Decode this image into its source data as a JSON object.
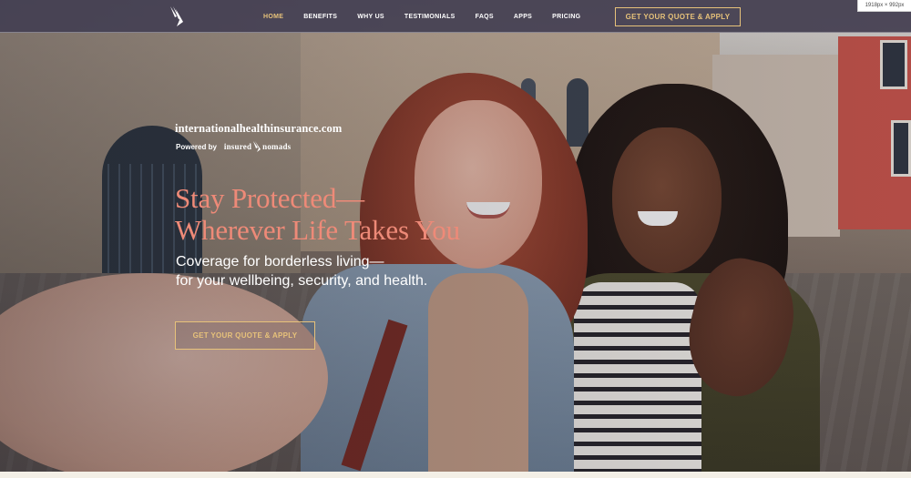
{
  "window": {
    "dimensions_badge": "1918px × 992px"
  },
  "navbar": {
    "logo_icon": "wing-logo-icon",
    "links": [
      {
        "label": "HOME",
        "active": true
      },
      {
        "label": "BENEFITS",
        "active": false
      },
      {
        "label": "WHY US",
        "active": false
      },
      {
        "label": "TESTIMONIALS",
        "active": false
      },
      {
        "label": "FAQS",
        "active": false
      },
      {
        "label": "APPS",
        "active": false
      },
      {
        "label": "PRICING",
        "active": false
      }
    ],
    "cta_label": "GET YOUR QUOTE & APPLY"
  },
  "hero": {
    "domain": "internationalhealthinsurance.com",
    "powered_by_label": "Powered by",
    "partner_name_a": "insured",
    "partner_name_b": "nomads",
    "headline_line1": "Stay Protected—",
    "headline_line2": "Wherever Life Takes You",
    "subheadline_line1": "Coverage for borderless living—",
    "subheadline_line2": "for your wellbeing, security, and health.",
    "cta_label": "GET YOUR QUOTE & APPLY"
  },
  "colors": {
    "accent_gold": "#e7c27a",
    "headline_coral": "#ee8a78",
    "nav_background": "#423e54",
    "text_white": "#ffffff"
  }
}
